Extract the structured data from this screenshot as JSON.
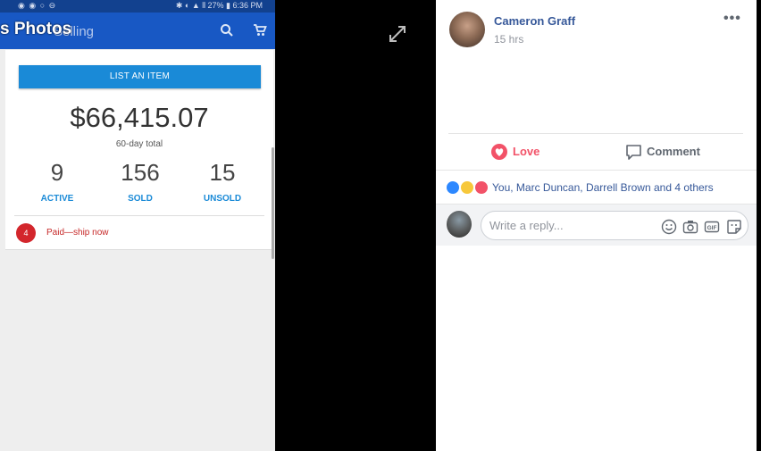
{
  "photo": {
    "status_bar": {
      "icons": "◉ ◉ ○ ⊖",
      "right": "✱ ◐ ▲ ⫴ 27% ▮ 6:36 PM"
    },
    "app_title": "Selling",
    "list_item_label": "LIST AN ITEM",
    "total_amount": "$66,415.07",
    "total_label": "60-day total",
    "stats": [
      {
        "value": "9",
        "label": "ACTIVE"
      },
      {
        "value": "156",
        "label": "SOLD"
      },
      {
        "value": "15",
        "label": "UNSOLD"
      }
    ],
    "alert": {
      "count": "4",
      "text": "Paid—ship now"
    }
  },
  "viewer": {
    "title": "s Photos"
  },
  "post": {
    "author": "Cameron Graff",
    "time": "15 hrs",
    "more": "•••",
    "actions": {
      "love": "Love",
      "comment": "Comment"
    },
    "reactions_text": "You, Marc Duncan, Darrell Brown and 4 others",
    "reply_placeholder": "Write a reply..."
  },
  "colors": {
    "fb_blue": "#365899",
    "love": "#f25268",
    "ebay_blue": "#1858c4"
  }
}
